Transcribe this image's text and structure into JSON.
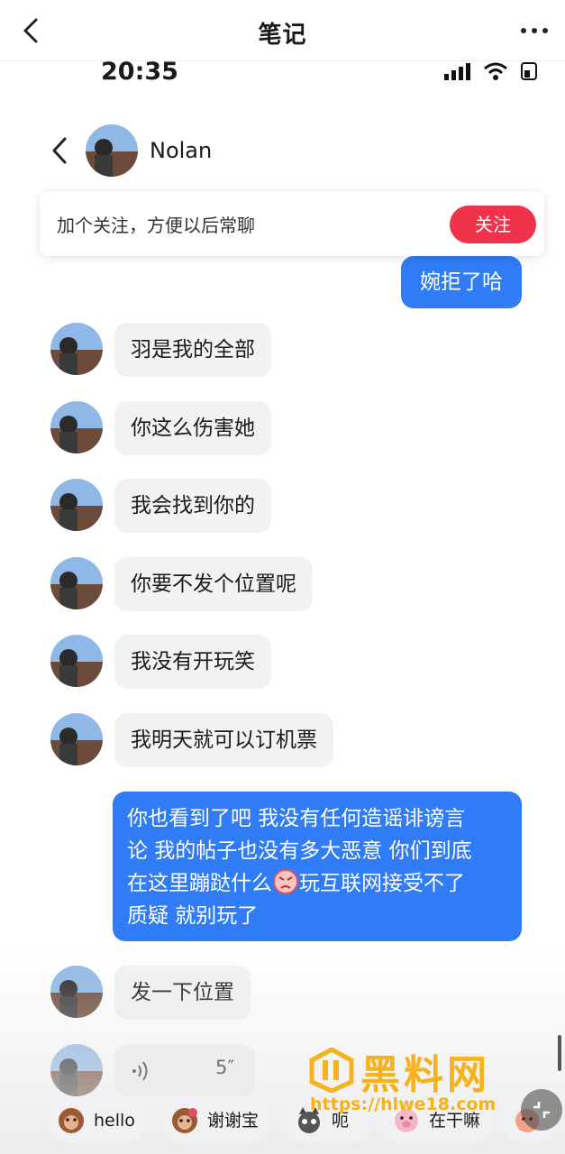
{
  "header": {
    "title": "笔记",
    "back_icon": "chevron-left-icon",
    "more_icon": "ellipsis-icon"
  },
  "status_bar": {
    "time": "20:35"
  },
  "chat": {
    "contact_name": "Nolan",
    "follow_prompt": "加个关注，方便以后常聊",
    "follow_button": "关注",
    "messages": [
      {
        "from": "me",
        "text": "婉拒了哈"
      },
      {
        "from": "them",
        "text": "羽是我的全部"
      },
      {
        "from": "them",
        "text": "你这么伤害她"
      },
      {
        "from": "them",
        "text": "我会找到你的"
      },
      {
        "from": "them",
        "text": "你要不发个位置呢"
      },
      {
        "from": "them",
        "text": "我没有开玩笑"
      },
      {
        "from": "them",
        "text": "我明天就可以订机票"
      },
      {
        "from": "me",
        "text_lines": [
          "你也看到了吧 我没有任何造谣诽谤言",
          "论 我的帖子也没有多大恶意 你们到底",
          "在这里蹦跶什么",
          "玩互联网接受不了",
          "质疑 就别玩了"
        ]
      },
      {
        "from": "them",
        "text": "发一下位置"
      },
      {
        "from": "them",
        "type": "voice",
        "duration": "5″"
      }
    ]
  },
  "quick_replies": [
    {
      "label": "hello",
      "icon": "monkey-sticker-icon"
    },
    {
      "label": "谢谢宝",
      "icon": "monkey-flower-sticker-icon"
    },
    {
      "label": "呃",
      "icon": "cat-sticker-icon"
    },
    {
      "label": "在干嘛",
      "icon": "pig-sticker-icon"
    },
    {
      "label": "",
      "icon": "sticker-icon"
    }
  ],
  "watermark": {
    "brand": "黑料网",
    "url": "https://hlwe18.com"
  },
  "colors": {
    "accent_red": "#f0334b",
    "bubble_blue": "#2f7cf6",
    "bubble_gray": "#f2f2f2",
    "watermark": "#f5b21a"
  }
}
